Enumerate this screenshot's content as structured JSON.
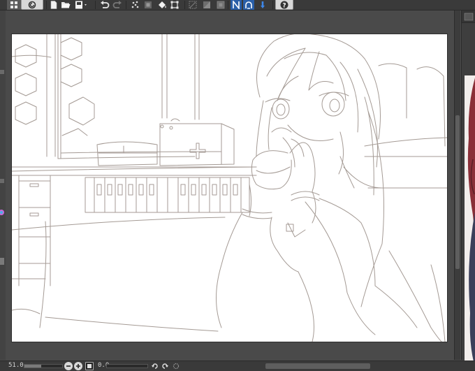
{
  "command_bar": {
    "tools": [
      {
        "name": "layout-menu-icon"
      },
      {
        "name": "app-logo-icon"
      },
      {
        "name": "new-file-icon"
      },
      {
        "name": "open-file-icon"
      },
      {
        "name": "save-file-icon"
      },
      {
        "name": "undo-icon"
      },
      {
        "name": "redo-icon"
      },
      {
        "name": "clear-icon"
      },
      {
        "name": "clear-outside-icon"
      },
      {
        "name": "fill-icon"
      },
      {
        "name": "transform-icon"
      },
      {
        "name": "deselect-icon"
      },
      {
        "name": "invert-selection-icon"
      },
      {
        "name": "show-selection-icon"
      },
      {
        "name": "snap-ruler-icon"
      },
      {
        "name": "snap-special-ruler-icon"
      },
      {
        "name": "snap-grid-icon"
      },
      {
        "name": "help-icon"
      }
    ]
  },
  "status_bar": {
    "zoom_value": "51.0",
    "zoom_level": 0.45,
    "angle_value": "0.0"
  },
  "colors": {
    "ui_dark": "#3a3a3a",
    "ui_mid": "#4a4a4a",
    "sketch_line": "#8a7f79",
    "active_tool": "#1e66c8"
  }
}
